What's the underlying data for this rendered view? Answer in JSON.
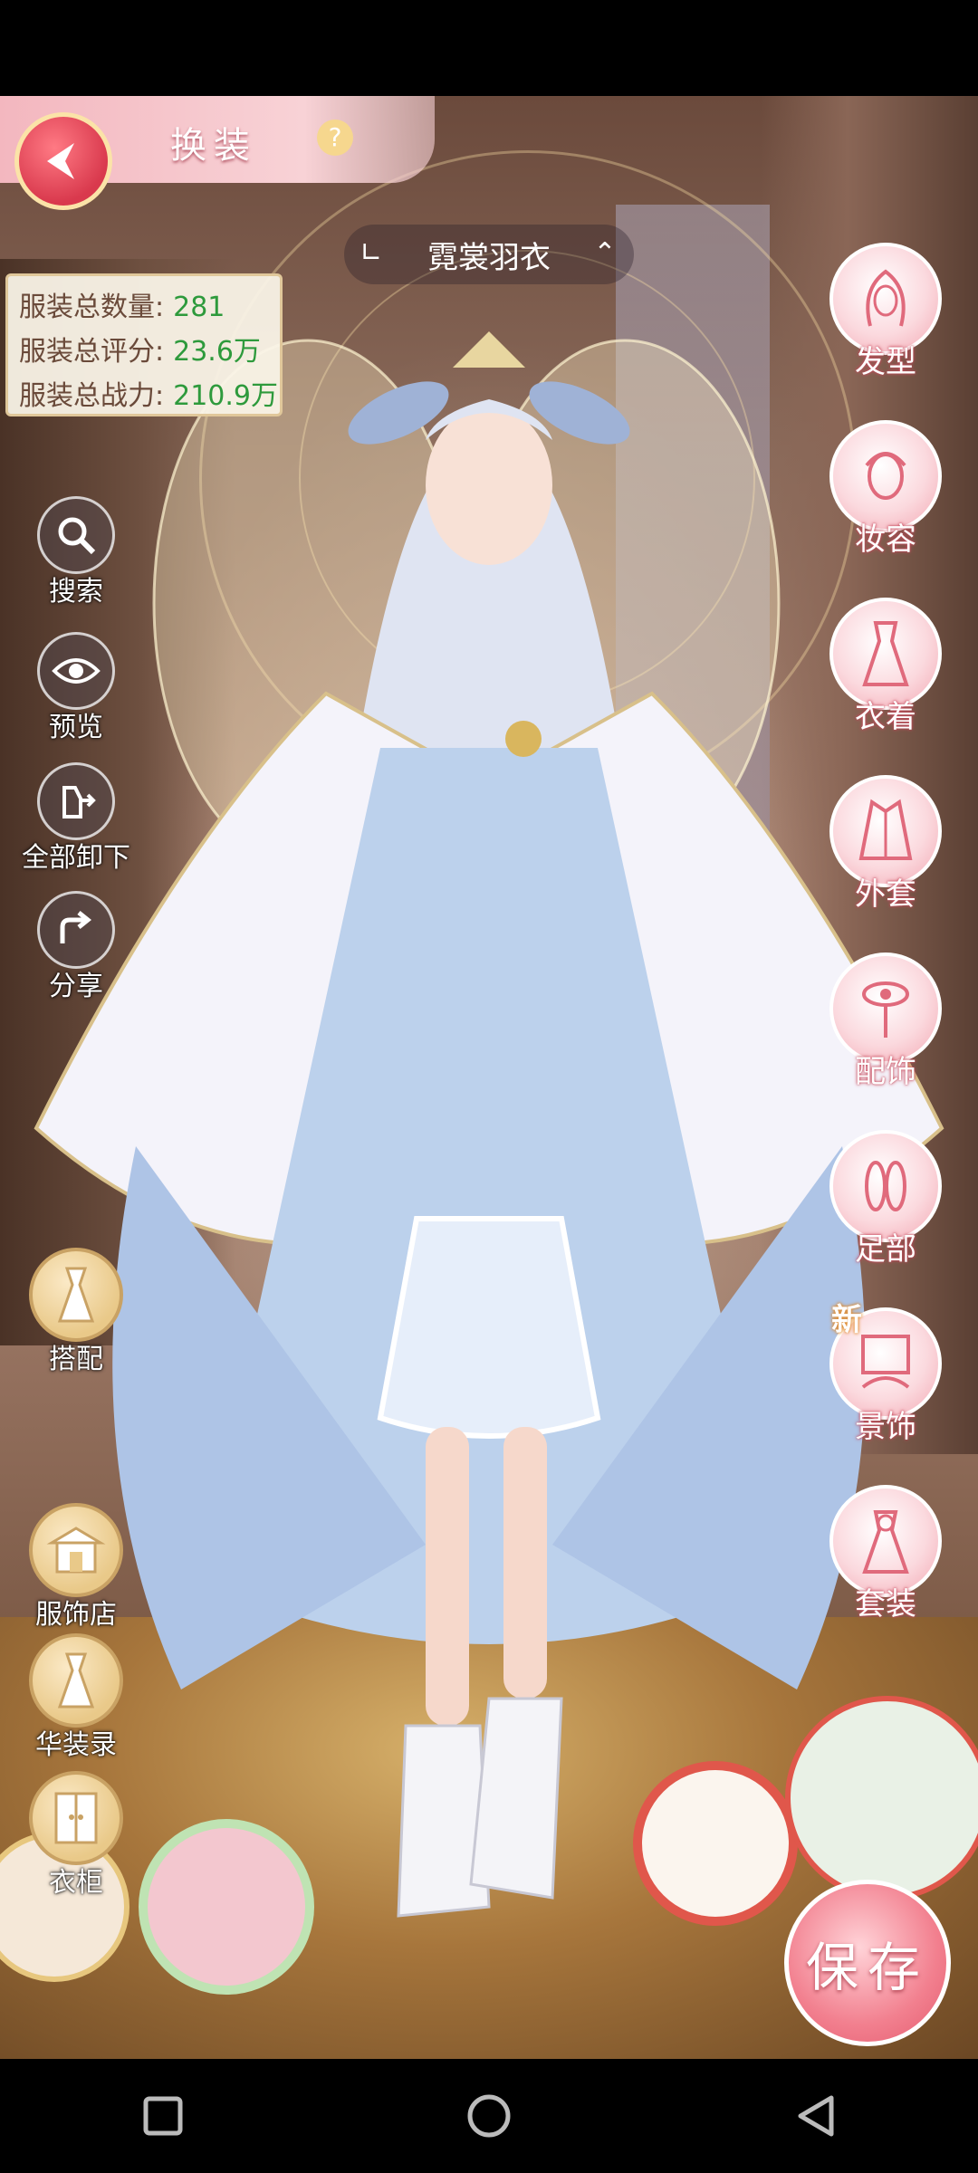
{
  "header": {
    "title": "换装",
    "help": "?"
  },
  "outfit": {
    "name": "霓裳羽衣"
  },
  "stats": [
    {
      "label": "服装总数量:",
      "value": "281"
    },
    {
      "label": "服装总评分:",
      "value": "23.6万"
    },
    {
      "label": "服装总战力:",
      "value": "210.9万"
    }
  ],
  "left_tools": [
    {
      "label": "搜索",
      "icon": "search-icon"
    },
    {
      "label": "预览",
      "icon": "eye-icon"
    },
    {
      "label": "全部卸下",
      "icon": "undress-icon"
    },
    {
      "label": "分享",
      "icon": "share-icon"
    }
  ],
  "left_shortcuts": [
    {
      "label": "搭配",
      "icon": "outfit-match-icon"
    },
    {
      "label": "服饰店",
      "icon": "shop-icon"
    },
    {
      "label": "华装录",
      "icon": "collection-icon"
    },
    {
      "label": "衣柜",
      "icon": "wardrobe-icon"
    }
  ],
  "categories": [
    {
      "label": "发型",
      "icon": "hair-icon"
    },
    {
      "label": "妆容",
      "icon": "makeup-icon"
    },
    {
      "label": "衣着",
      "icon": "dress-icon"
    },
    {
      "label": "外套",
      "icon": "coat-icon"
    },
    {
      "label": "配饰",
      "icon": "accessory-icon"
    },
    {
      "label": "足部",
      "icon": "shoes-icon"
    },
    {
      "label": "景饰",
      "icon": "scenery-icon",
      "badge": "新"
    },
    {
      "label": "套装",
      "icon": "suit-icon"
    }
  ],
  "save": {
    "label": "保存"
  },
  "colors": {
    "accent_pink": "#f2808f",
    "stat_green": "#2e9a3c",
    "header_pink": "#f3b7bf"
  }
}
